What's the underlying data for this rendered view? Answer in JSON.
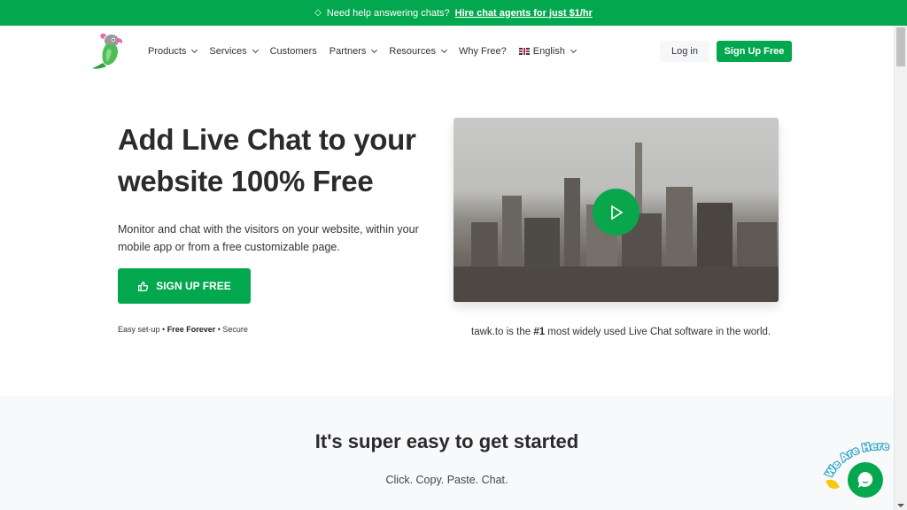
{
  "announcement": {
    "icon": "diamond-icon",
    "text": "Need help answering chats?",
    "link": "Hire chat agents for just $1/hr"
  },
  "nav": {
    "logo": "tawk.to parrot logo",
    "items": [
      {
        "label": "Products",
        "dropdown": true
      },
      {
        "label": "Services",
        "dropdown": true
      },
      {
        "label": "Customers",
        "dropdown": false
      },
      {
        "label": "Partners",
        "dropdown": true
      },
      {
        "label": "Resources",
        "dropdown": true
      },
      {
        "label": "Why Free?",
        "dropdown": false
      }
    ],
    "language": "English",
    "login": "Log in",
    "signup": "Sign Up Free"
  },
  "hero": {
    "title": "Add Live Chat to your website 100% Free",
    "description": "Monitor and chat with the visitors on your website, within your mobile app or from a free customizable page.",
    "cta": "SIGN UP FREE",
    "features": [
      "Easy set-up",
      "Free Forever",
      "Secure"
    ],
    "caption_pre": "tawk.to is the ",
    "caption_bold": "#1",
    "caption_post": " most widely used Live Chat software in the world."
  },
  "section2": {
    "title": "It's super easy to get started",
    "subtitle": "Click. Copy. Paste. Chat."
  },
  "widget": {
    "label": "We Are Here!"
  },
  "colors": {
    "brand_green": "#03a84e",
    "text_dark": "#2b2b2b"
  }
}
